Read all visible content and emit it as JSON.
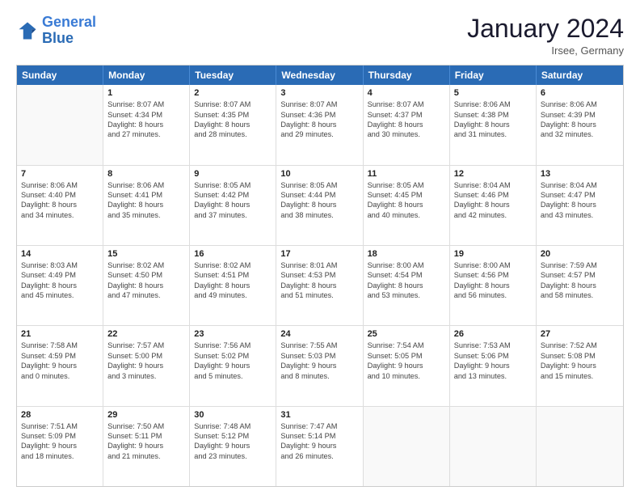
{
  "header": {
    "logo_general": "General",
    "logo_blue": "Blue",
    "month_title": "January 2024",
    "location": "Irsee, Germany"
  },
  "weekdays": [
    "Sunday",
    "Monday",
    "Tuesday",
    "Wednesday",
    "Thursday",
    "Friday",
    "Saturday"
  ],
  "weeks": [
    [
      {
        "day": "",
        "empty": true
      },
      {
        "day": "1",
        "lines": [
          "Sunrise: 8:07 AM",
          "Sunset: 4:34 PM",
          "Daylight: 8 hours",
          "and 27 minutes."
        ]
      },
      {
        "day": "2",
        "lines": [
          "Sunrise: 8:07 AM",
          "Sunset: 4:35 PM",
          "Daylight: 8 hours",
          "and 28 minutes."
        ]
      },
      {
        "day": "3",
        "lines": [
          "Sunrise: 8:07 AM",
          "Sunset: 4:36 PM",
          "Daylight: 8 hours",
          "and 29 minutes."
        ]
      },
      {
        "day": "4",
        "lines": [
          "Sunrise: 8:07 AM",
          "Sunset: 4:37 PM",
          "Daylight: 8 hours",
          "and 30 minutes."
        ]
      },
      {
        "day": "5",
        "lines": [
          "Sunrise: 8:06 AM",
          "Sunset: 4:38 PM",
          "Daylight: 8 hours",
          "and 31 minutes."
        ]
      },
      {
        "day": "6",
        "lines": [
          "Sunrise: 8:06 AM",
          "Sunset: 4:39 PM",
          "Daylight: 8 hours",
          "and 32 minutes."
        ]
      }
    ],
    [
      {
        "day": "7",
        "lines": [
          "Sunrise: 8:06 AM",
          "Sunset: 4:40 PM",
          "Daylight: 8 hours",
          "and 34 minutes."
        ]
      },
      {
        "day": "8",
        "lines": [
          "Sunrise: 8:06 AM",
          "Sunset: 4:41 PM",
          "Daylight: 8 hours",
          "and 35 minutes."
        ]
      },
      {
        "day": "9",
        "lines": [
          "Sunrise: 8:05 AM",
          "Sunset: 4:42 PM",
          "Daylight: 8 hours",
          "and 37 minutes."
        ]
      },
      {
        "day": "10",
        "lines": [
          "Sunrise: 8:05 AM",
          "Sunset: 4:44 PM",
          "Daylight: 8 hours",
          "and 38 minutes."
        ]
      },
      {
        "day": "11",
        "lines": [
          "Sunrise: 8:05 AM",
          "Sunset: 4:45 PM",
          "Daylight: 8 hours",
          "and 40 minutes."
        ]
      },
      {
        "day": "12",
        "lines": [
          "Sunrise: 8:04 AM",
          "Sunset: 4:46 PM",
          "Daylight: 8 hours",
          "and 42 minutes."
        ]
      },
      {
        "day": "13",
        "lines": [
          "Sunrise: 8:04 AM",
          "Sunset: 4:47 PM",
          "Daylight: 8 hours",
          "and 43 minutes."
        ]
      }
    ],
    [
      {
        "day": "14",
        "lines": [
          "Sunrise: 8:03 AM",
          "Sunset: 4:49 PM",
          "Daylight: 8 hours",
          "and 45 minutes."
        ]
      },
      {
        "day": "15",
        "lines": [
          "Sunrise: 8:02 AM",
          "Sunset: 4:50 PM",
          "Daylight: 8 hours",
          "and 47 minutes."
        ]
      },
      {
        "day": "16",
        "lines": [
          "Sunrise: 8:02 AM",
          "Sunset: 4:51 PM",
          "Daylight: 8 hours",
          "and 49 minutes."
        ]
      },
      {
        "day": "17",
        "lines": [
          "Sunrise: 8:01 AM",
          "Sunset: 4:53 PM",
          "Daylight: 8 hours",
          "and 51 minutes."
        ]
      },
      {
        "day": "18",
        "lines": [
          "Sunrise: 8:00 AM",
          "Sunset: 4:54 PM",
          "Daylight: 8 hours",
          "and 53 minutes."
        ]
      },
      {
        "day": "19",
        "lines": [
          "Sunrise: 8:00 AM",
          "Sunset: 4:56 PM",
          "Daylight: 8 hours",
          "and 56 minutes."
        ]
      },
      {
        "day": "20",
        "lines": [
          "Sunrise: 7:59 AM",
          "Sunset: 4:57 PM",
          "Daylight: 8 hours",
          "and 58 minutes."
        ]
      }
    ],
    [
      {
        "day": "21",
        "lines": [
          "Sunrise: 7:58 AM",
          "Sunset: 4:59 PM",
          "Daylight: 9 hours",
          "and 0 minutes."
        ]
      },
      {
        "day": "22",
        "lines": [
          "Sunrise: 7:57 AM",
          "Sunset: 5:00 PM",
          "Daylight: 9 hours",
          "and 3 minutes."
        ]
      },
      {
        "day": "23",
        "lines": [
          "Sunrise: 7:56 AM",
          "Sunset: 5:02 PM",
          "Daylight: 9 hours",
          "and 5 minutes."
        ]
      },
      {
        "day": "24",
        "lines": [
          "Sunrise: 7:55 AM",
          "Sunset: 5:03 PM",
          "Daylight: 9 hours",
          "and 8 minutes."
        ]
      },
      {
        "day": "25",
        "lines": [
          "Sunrise: 7:54 AM",
          "Sunset: 5:05 PM",
          "Daylight: 9 hours",
          "and 10 minutes."
        ]
      },
      {
        "day": "26",
        "lines": [
          "Sunrise: 7:53 AM",
          "Sunset: 5:06 PM",
          "Daylight: 9 hours",
          "and 13 minutes."
        ]
      },
      {
        "day": "27",
        "lines": [
          "Sunrise: 7:52 AM",
          "Sunset: 5:08 PM",
          "Daylight: 9 hours",
          "and 15 minutes."
        ]
      }
    ],
    [
      {
        "day": "28",
        "lines": [
          "Sunrise: 7:51 AM",
          "Sunset: 5:09 PM",
          "Daylight: 9 hours",
          "and 18 minutes."
        ]
      },
      {
        "day": "29",
        "lines": [
          "Sunrise: 7:50 AM",
          "Sunset: 5:11 PM",
          "Daylight: 9 hours",
          "and 21 minutes."
        ]
      },
      {
        "day": "30",
        "lines": [
          "Sunrise: 7:48 AM",
          "Sunset: 5:12 PM",
          "Daylight: 9 hours",
          "and 23 minutes."
        ]
      },
      {
        "day": "31",
        "lines": [
          "Sunrise: 7:47 AM",
          "Sunset: 5:14 PM",
          "Daylight: 9 hours",
          "and 26 minutes."
        ]
      },
      {
        "day": "",
        "empty": true
      },
      {
        "day": "",
        "empty": true
      },
      {
        "day": "",
        "empty": true
      }
    ]
  ]
}
